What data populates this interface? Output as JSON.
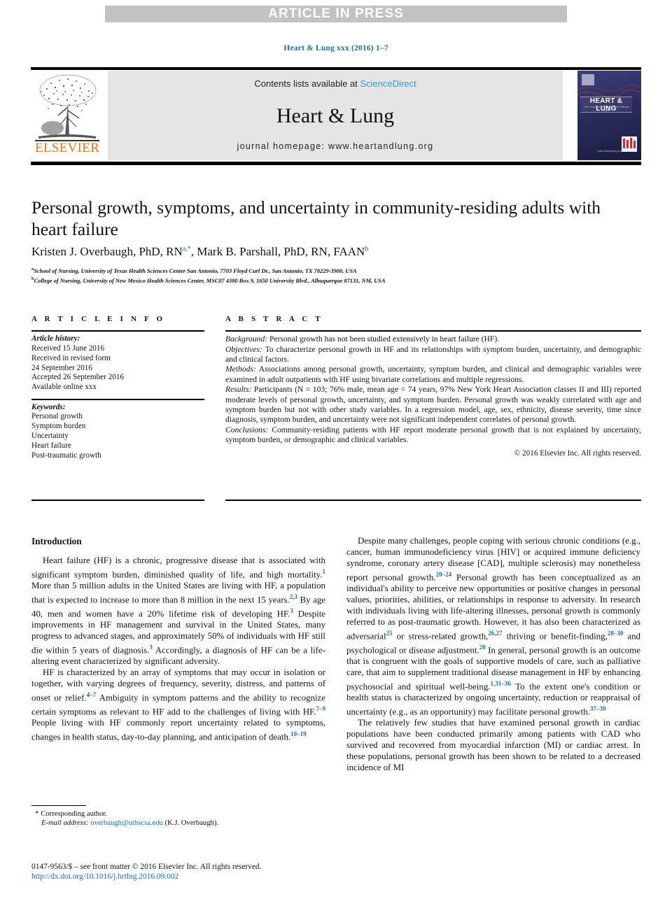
{
  "banner": {
    "text": "ARTICLE IN PRESS"
  },
  "running_head": {
    "citation": "Heart & Lung xxx (2016) 1–7"
  },
  "masthead": {
    "publisher_name": "ELSEVIER",
    "contents_prefix": "Contents lists available at ",
    "contents_link": "ScienceDirect",
    "journal_title": "Heart & Lung",
    "homepage": "journal homepage: www.heartandlung.org",
    "cover": {
      "title": "HEART & LUNG",
      "subtitle": "The Journal of Acute and Critical Care",
      "url": "www.heartandlung.org"
    }
  },
  "article": {
    "title": "Personal growth, symptoms, and uncertainty in community-residing adults with heart failure",
    "authors_html": "Kristen J. Overbaugh, PhD, RN<sup>a,*</sup>, Mark B. Parshall, PhD, RN, FAAN<sup>b</sup>",
    "affiliations": [
      "School of Nursing, University of Texas Health Sciences Center San Antonio, 7703 Floyd Curl Dr., San Antonio, TX 78229-3900, USA",
      "College of Nursing, University of New Mexico Health Sciences Center, MSC07 4380 Box 9, 1650 University Blvd., Albuquerque 87131, NM, USA"
    ],
    "affiliation_markers": [
      "a",
      "b"
    ]
  },
  "article_info": {
    "heading": "A R T I C L E   I N F O",
    "history_label": "Article history:",
    "history": [
      "Received 15 June 2016",
      "Received in revised form",
      "24 September 2016",
      "Accepted 26 September 2016",
      "Available online xxx"
    ],
    "keywords_label": "Keywords:",
    "keywords": [
      "Personal growth",
      "Symptom burden",
      "Uncertainty",
      "Heart failure",
      "Post-traumatic growth"
    ]
  },
  "abstract": {
    "heading": "A B S T R A C T",
    "sections": [
      {
        "label": "Background:",
        "text": " Personal growth has not been studied extensively in heart failure (HF)."
      },
      {
        "label": "Objectives:",
        "text": " To characterize personal growth in HF and its relationships with symptom burden, uncertainty, and demographic and clinical factors."
      },
      {
        "label": "Methods:",
        "text": " Associations among personal growth, uncertainty, symptom burden, and clinical and demographic variables were examined in adult outpatients with HF using bivariate correlations and multiple regressions."
      },
      {
        "label": "Results:",
        "text": " Participants (N = 103; 76% male, mean age = 74 years, 97% New York Heart Association classes II and III) reported moderate levels of personal growth, uncertainty, and symptom burden. Personal growth was weakly correlated with age and symptom burden but not with other study variables. In a regression model, age, sex, ethnicity, disease severity, time since diagnosis, symptom burden, and uncertainty were not significant independent correlates of personal growth."
      },
      {
        "label": "Conclusions:",
        "text": " Community-residing patients with HF report moderate personal growth that is not explained by uncertainty, symptom burden, or demographic and clinical variables."
      }
    ],
    "copyright": "© 2016 Elsevier Inc. All rights reserved."
  },
  "body": {
    "left_heading": "Introduction",
    "left_paragraphs": [
      "Heart failure (HF) is a chronic, progressive disease that is associated with significant symptom burden, diminished quality of life, and high mortality.<sup class=\"ref\">1</sup> More than 5 million adults in the United States are living with HF, a population that is expected to increase to more than 8 million in the next 15 years.<sup class=\"ref\">2,3</sup> By age 40, men and women have a 20% lifetime risk of developing HF.<sup class=\"ref\">3</sup> Despite improvements in HF management and survival in the United States, many progress to advanced stages, and approximately 50% of individuals with HF still die within 5 years of diagnosis.<sup class=\"ref\">3</sup> Accordingly, a diagnosis of HF can be a life-altering event characterized by significant adversity.",
      "HF is characterized by an array of symptoms that may occur in isolation or together, with varying degrees of frequency, severity, distress, and patterns of onset or relief.<sup class=\"ref\">4–7</sup> Ambiguity in symptom patterns and the ability to recognize certain symptoms as relevant to HF add to the challenges of living with HF.<sup class=\"ref\">7–9</sup> People living with HF commonly report uncertainty related to symptoms, changes in health status, day-to-day planning, and anticipation of death.<sup class=\"ref\">10–19</sup>"
    ],
    "right_paragraphs": [
      "Despite many challenges, people coping with serious chronic conditions (e.g., cancer, human immunodeficiency virus [HIV] or acquired immune deficiency syndrome, coronary artery disease [CAD], multiple sclerosis) may nonetheless report personal growth.<sup class=\"ref\">20–24</sup> Personal growth has been conceptualized as an individual's ability to perceive new opportunities or positive changes in personal values, priorities, abilities, or relationships in response to adversity. In research with individuals living with life-altering illnesses, personal growth is commonly referred to as post-traumatic growth. However, it has also been characterized as adversarial<sup class=\"ref\">25</sup> or stress-related growth,<sup class=\"ref\">26,27</sup> thriving or benefit-finding,<sup class=\"ref\">28–30</sup> and psychological or disease adjustment.<sup class=\"ref\">20</sup> In general, personal growth is an outcome that is congruent with the goals of supportive models of care, such as palliative care, that aim to supplement traditional disease management in HF by enhancing psychosocial and spiritual well-being.<sup class=\"ref\">1,31–36</sup> To the extent one's condition or health status is characterized by ongoing uncertainty, reduction or reappraisal of uncertainty (e.g., as an opportunity) may facilitate personal growth.<sup class=\"ref\">37–39</sup>",
      "The relatively few studies that have examined personal growth in cardiac populations have been conducted primarily among patients with CAD who survived and recovered from myocardial infarction (MI) or cardiac arrest. In these populations, personal growth has been shown to be related to a decreased incidence of MI"
    ]
  },
  "footer": {
    "corresponding_marker": "*",
    "corresponding_label": "Corresponding author.",
    "email_label": "E-mail address:",
    "email": "overbaugh@uthscsa.edu",
    "email_suffix": "(K.J. Overbaugh).",
    "imprint": "0147-9563/$ – see front matter © 2016 Elsevier Inc. All rights reserved.",
    "doi": "http://dx.doi.org/10.1016/j.hrtlng.2016.09.002"
  },
  "colors": {
    "banner_bg": "#c2c2c2",
    "link_blue": "#1a6ea8",
    "sciencedirect_blue": "#2e9bd6",
    "elsevier_orange": "#e87722",
    "masthead_box": "#e5e5e5"
  }
}
